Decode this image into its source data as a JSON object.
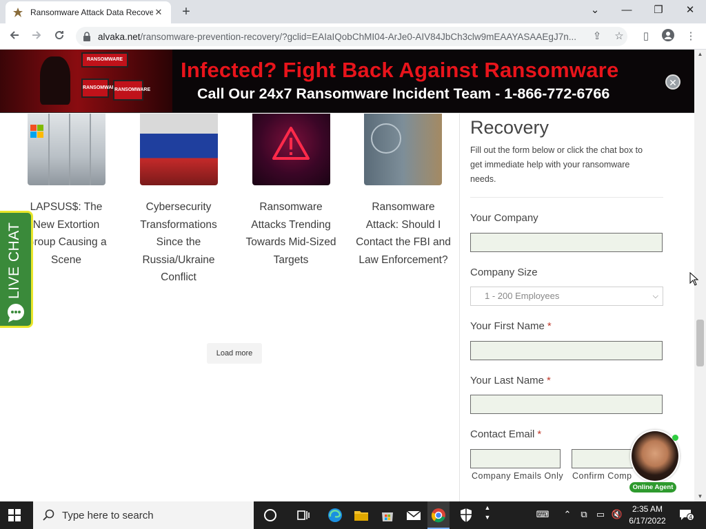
{
  "browser": {
    "tab_title": "Ransomware Attack Data Recove",
    "tab_close": "✕",
    "new_tab": "+",
    "url_domain": "alvaka.net",
    "url_path": "/ransomware-prevention-recovery/?gclid=EAIaIQobChMI04-ArJe0-AIV84JbCh3clw9mEAAYASAAEgJ7n...",
    "window_controls": {
      "dropdown": "⌄",
      "minimize": "—",
      "restore": "❐",
      "close": "✕"
    }
  },
  "banner": {
    "headline": "Infected? Fight Back Against Ransomware",
    "subline": "Call Our 24x7 Ransomware Incident Team - 1-866-772-6766",
    "art_label_top": "RANSOMWARE",
    "art_label_a": "RANSOMWARE",
    "art_label_b": "RANSOMWARE",
    "close": "✕"
  },
  "articles": [
    {
      "title": "LAPSUS$: The New Extortion Group Causing a Scene"
    },
    {
      "title": "Cybersecurity Transformations Since the Russia/Ukraine Conflict"
    },
    {
      "title": "Ransomware Attacks Trending Towards Mid-Sized Targets"
    },
    {
      "title": "Ransomware Attack: Should I Contact the FBI and Law Enforcement?"
    }
  ],
  "load_more": "Load more",
  "live_chat": "LIVE CHAT",
  "form": {
    "title": "Recovery",
    "description": "Fill out the form below or click the chat box to get immediate help with your ransomware needs.",
    "company_label": "Your Company",
    "size_label": "Company Size",
    "size_value": "1 - 200 Employees",
    "first_name_label": "Your First Name",
    "last_name_label": "Your Last Name",
    "email_label": "Contact Email",
    "required_mark": "*",
    "email_hint": "Company Emails Only",
    "confirm_hint": "Confirm Comp"
  },
  "agent_badge": "Online Agent",
  "taskbar": {
    "search_placeholder": "Type here to search",
    "time": "2:35 AM",
    "date": "6/17/2022",
    "notif_count": "4"
  }
}
